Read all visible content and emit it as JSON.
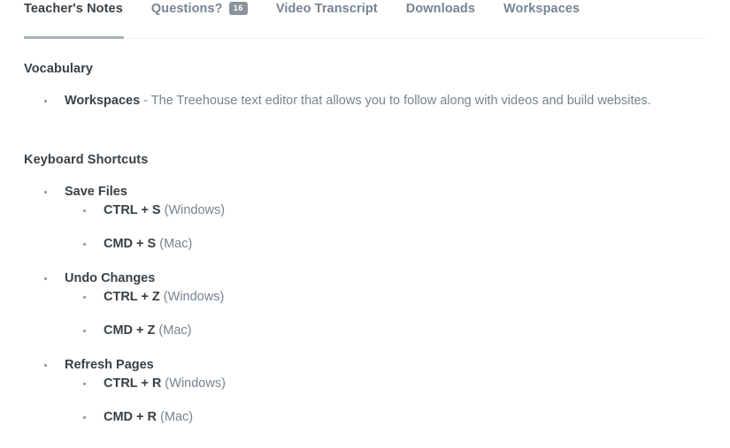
{
  "tabs": [
    {
      "label": "Teacher's Notes",
      "active": true,
      "badge": null
    },
    {
      "label": "Questions?",
      "active": false,
      "badge": "16"
    },
    {
      "label": "Video Transcript",
      "active": false,
      "badge": null
    },
    {
      "label": "Downloads",
      "active": false,
      "badge": null
    },
    {
      "label": "Workspaces",
      "active": false,
      "badge": null
    }
  ],
  "sections": {
    "vocabulary": {
      "title": "Vocabulary",
      "items": [
        {
          "term": "Workspaces",
          "definition": " - The Treehouse text editor that allows you to follow along with videos and build websites."
        }
      ]
    },
    "shortcuts": {
      "title": "Keyboard Shortcuts",
      "groups": [
        {
          "name": "Save Files",
          "keys": [
            {
              "combo": "CTRL + S",
              "platform": " (Windows)"
            },
            {
              "combo": "CMD + S",
              "platform": " (Mac)"
            }
          ]
        },
        {
          "name": "Undo Changes",
          "keys": [
            {
              "combo": "CTRL + Z",
              "platform": " (Windows)"
            },
            {
              "combo": "CMD + Z",
              "platform": " (Mac)"
            }
          ]
        },
        {
          "name": "Refresh Pages",
          "keys": [
            {
              "combo": "CTRL + R",
              "platform": " (Windows)"
            },
            {
              "combo": "CMD + R",
              "platform": " (Mac)"
            }
          ]
        }
      ]
    }
  },
  "colors": {
    "active_tab_text": "#384047",
    "inactive_tab_text": "#77838f",
    "badge_bg": "#8a939b",
    "underline": "#a7b0b8",
    "body_text": "#77838f",
    "heading_text": "#384047"
  }
}
